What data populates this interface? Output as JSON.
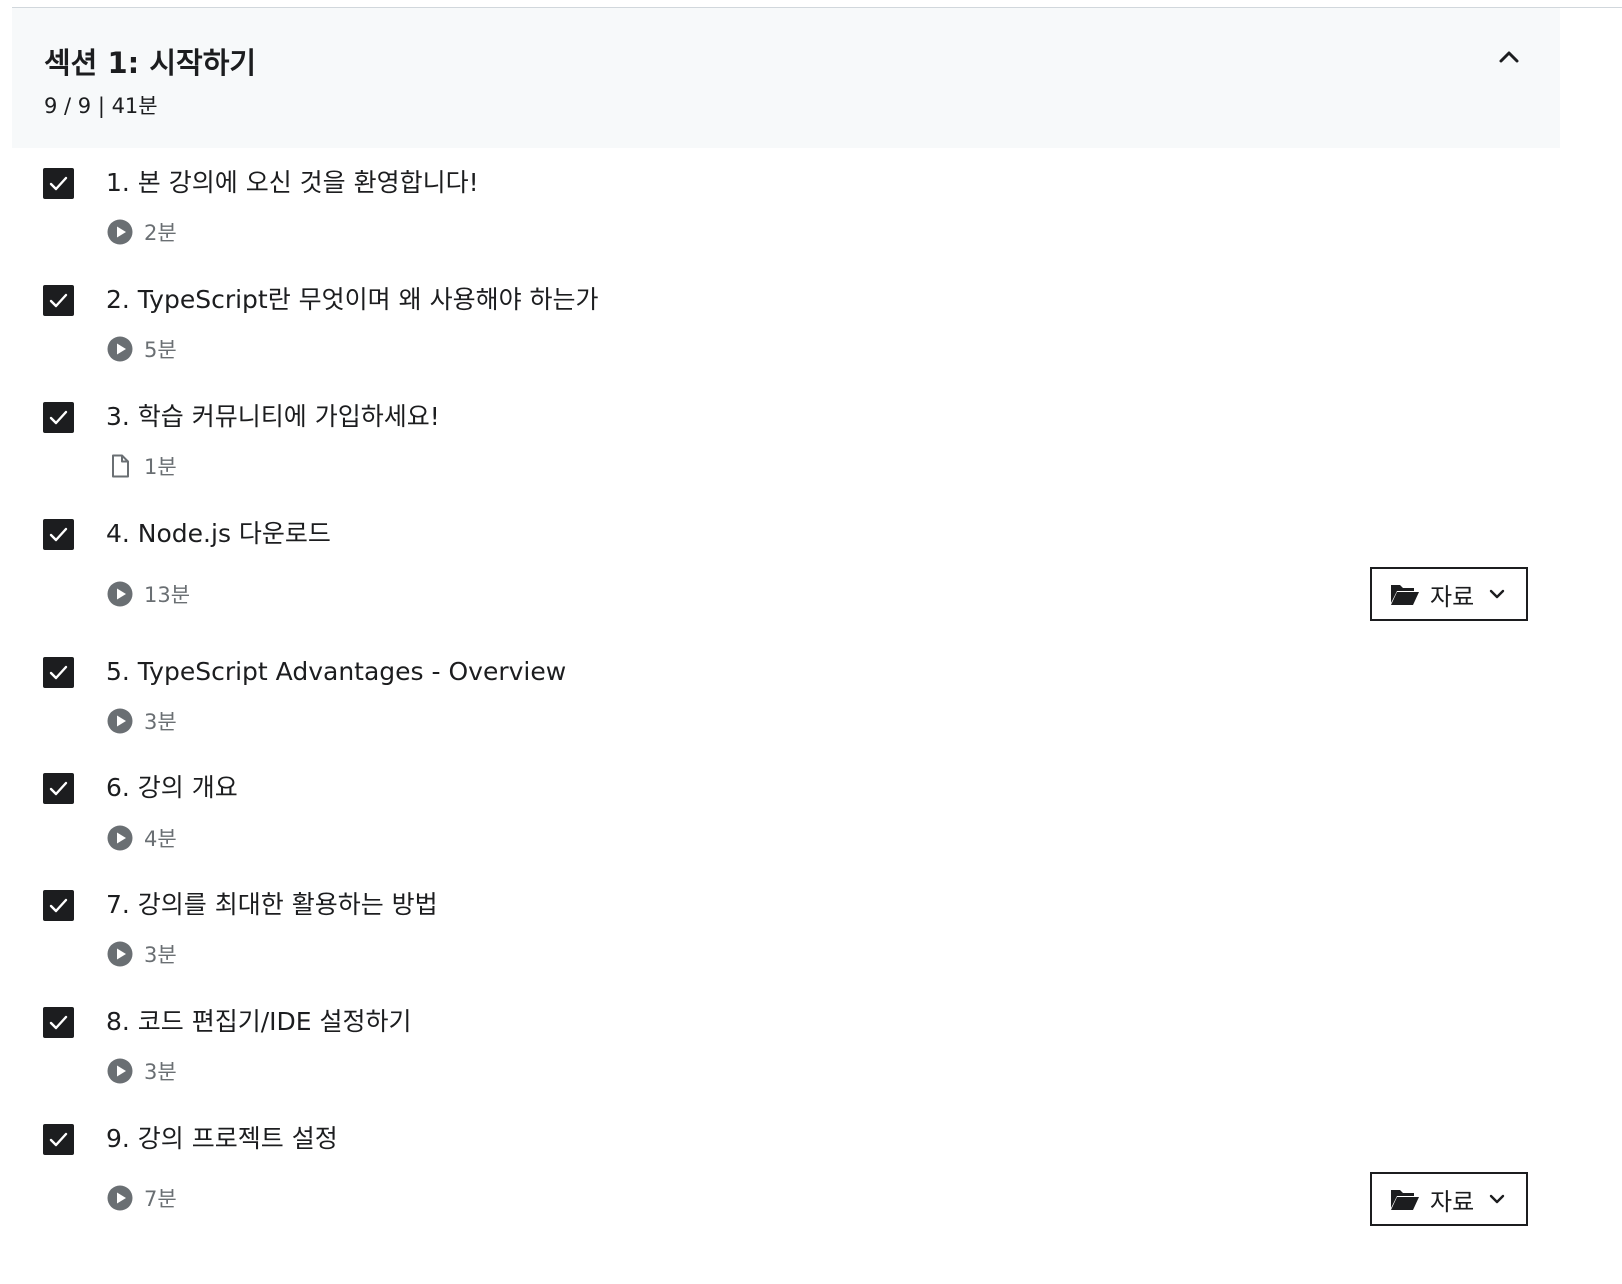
{
  "section": {
    "title": "섹션 1: 시작하기",
    "meta": "9 / 9 | 41분",
    "collapse_icon": "chevron-up-icon"
  },
  "lectures": [
    {
      "title": "1. 본 강의에 오신 것을 환영합니다!",
      "duration": "2분",
      "type": "video",
      "completed": true,
      "resources": false
    },
    {
      "title": "2. TypeScript란 무엇이며 왜 사용해야 하는가",
      "duration": "5분",
      "type": "video",
      "completed": true,
      "resources": false
    },
    {
      "title": "3. 학습 커뮤니티에 가입하세요!",
      "duration": "1분",
      "type": "article",
      "completed": true,
      "resources": false
    },
    {
      "title": "4. Node.js 다운로드",
      "duration": "13분",
      "type": "video",
      "completed": true,
      "resources": true
    },
    {
      "title": "5. TypeScript Advantages - Overview",
      "duration": "3분",
      "type": "video",
      "completed": true,
      "resources": false
    },
    {
      "title": "6. 강의 개요",
      "duration": "4분",
      "type": "video",
      "completed": true,
      "resources": false
    },
    {
      "title": "7. 강의를 최대한 활용하는 방법",
      "duration": "3분",
      "type": "video",
      "completed": true,
      "resources": false
    },
    {
      "title": "8. 코드 편집기/IDE 설정하기",
      "duration": "3분",
      "type": "video",
      "completed": true,
      "resources": false
    },
    {
      "title": "9. 강의 프로젝트 설정",
      "duration": "7분",
      "type": "video",
      "completed": true,
      "resources": true
    }
  ],
  "resources_label": "자료",
  "colors": {
    "text": "#1c1d1f",
    "muted": "#6a6f73",
    "header_bg": "#f7f9fa",
    "checkbox": "#1c1d1f"
  }
}
